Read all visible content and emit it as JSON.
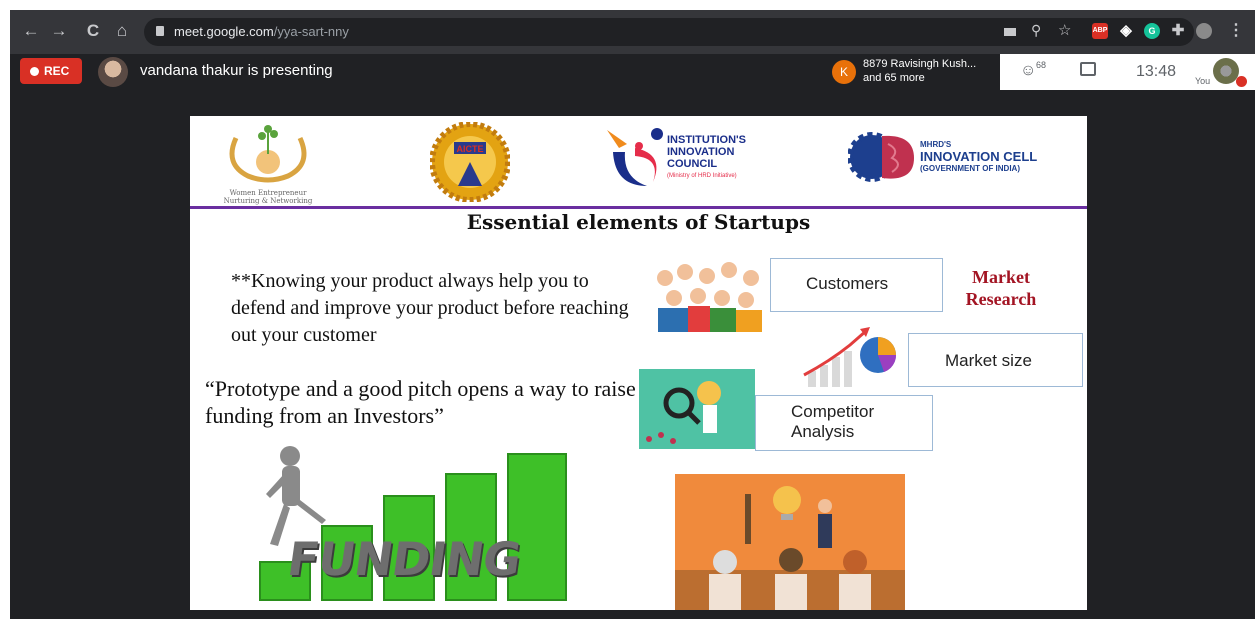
{
  "browser": {
    "url_host": "meet.google.com",
    "url_path": "/yya-sart-nny",
    "nav": {
      "back_glyph": "←",
      "forward_glyph": "→",
      "reload_glyph": "C",
      "home_glyph": "⌂"
    },
    "ext_abp": "ABP",
    "ext_grammarly": "G",
    "menu_glyph": "⋮"
  },
  "meet": {
    "rec_label": "REC",
    "presenter_text": "vandana thakur is presenting",
    "participant_initial": "K",
    "participant_line1": "8879 Ravisingh Kush...",
    "participant_line2": "and 65 more",
    "people_count": "68",
    "clock": "13:48",
    "you_label": "You"
  },
  "slide": {
    "title": "Essential elements of Startups",
    "logos": {
      "wenn_text": "Women Entrepreneur Nurturing & Networking",
      "aicte_text": "AICTE",
      "iic_line1": "INSTITUTION'S",
      "iic_line2": "INNOVATION",
      "iic_line3": "COUNCIL",
      "iic_line4": "(Ministry of HRD Initiative)",
      "mhrd_line1": "MHRD'S",
      "mhrd_line2": "INNOVATION CELL",
      "mhrd_line3": "(GOVERNMENT OF INDIA)"
    },
    "note_text": "**Knowing your product always help you to defend and improve your product before reaching out your customer",
    "quote_text": "“Prototype and a good pitch opens a way to raise funding from an Investors”",
    "customers_label": "Customers",
    "market_research_label": "Market Research",
    "market_size_label": "Market size",
    "competitor_label": "Competitor Analysis",
    "funding_word": "FUNDING"
  },
  "colors": {
    "rec_red": "#d93025",
    "slide_rule_purple": "#6a2fa0",
    "market_research_red": "#a31423",
    "funding_green": "#3ec028"
  }
}
